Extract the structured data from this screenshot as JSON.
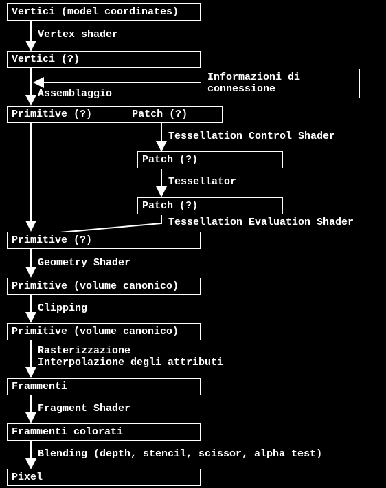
{
  "boxes": {
    "vertici_model": "Vertici (model coordinates)",
    "vertici": "Vertici (?)",
    "conn_info": "Informazioni di\nconnessione",
    "primitive_patch": {
      "left": "Primitive (?)",
      "right": "Patch (?)"
    },
    "patch1": "Patch (?)",
    "patch2": "Patch (?)",
    "primitive2": "Primitive (?)",
    "primitive_vc1": "Primitive (volume canonico)",
    "primitive_vc2": "Primitive (volume canonico)",
    "frammenti": "Frammenti",
    "frammenti_col": "Frammenti colorati",
    "pixel": "Pixel"
  },
  "labels": {
    "vertex_shader": "Vertex shader",
    "assemblaggio": "Assemblaggio",
    "tess_control": "Tessellation Control Shader",
    "tessellator": "Tessellator",
    "tess_eval": "Tessellation Evaluation Shader",
    "geometry": "Geometry Shader",
    "clipping": "Clipping",
    "raster": "Rasterizzazione\nInterpolazione degli attributi",
    "fragment": "Fragment Shader",
    "blending": "Blending (depth, stencil, scissor, alpha test)"
  }
}
